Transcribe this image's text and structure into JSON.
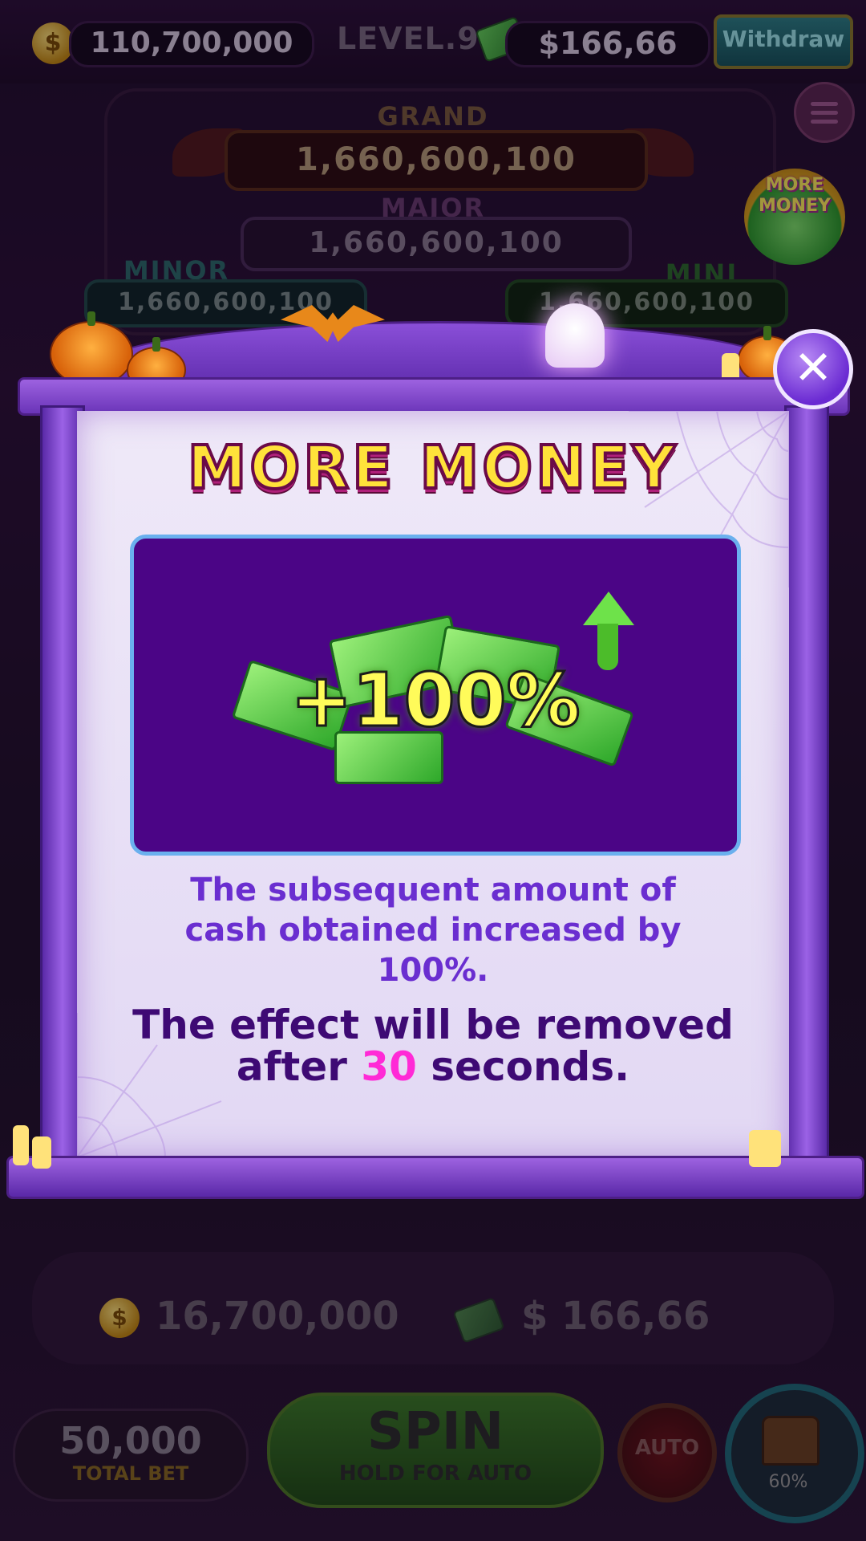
{
  "topbar": {
    "coin_balance": "110,700,000",
    "level_label": "LEVEL.9",
    "cash_balance": "$166,66",
    "withdraw_label": "Withdraw"
  },
  "jackpots": {
    "grand": {
      "label": "GRAND",
      "value": "1,660,600,100"
    },
    "major": {
      "label": "MAJOR",
      "value": "1,660,600,100"
    },
    "minor": {
      "label": "MINOR",
      "value": "1,660,600,100"
    },
    "mini": {
      "label": "MINI",
      "value": "1,660,600,100"
    }
  },
  "badge": {
    "line1": "MORE",
    "line2": "MONEY"
  },
  "popup": {
    "title": "MORE MONEY",
    "bonus_text": "+100%",
    "description": "The subsequent amount of cash obtained increased by 100%.",
    "effect_line1": "The effect will be removed",
    "effect_prefix": "after",
    "effect_seconds": "30",
    "effect_suffix": "seconds.",
    "close_glyph": "✕"
  },
  "bottom": {
    "coin_amount": "16,700,000",
    "cash_amount": "$ 166,66",
    "total_bet_value": "50,000",
    "total_bet_label": "TOTAL BET",
    "spin_label": "SPIN",
    "spin_sub_label": "HOLD FOR AUTO",
    "auto_label": "AUTO",
    "chest_progress": "60%"
  },
  "icons": {
    "coin": "coin-icon",
    "cash": "cash-stack-icon",
    "menu": "hamburger-menu-icon",
    "close": "close-icon",
    "chest": "treasure-chest-icon"
  },
  "colors": {
    "popup_purple": "#6a34b8",
    "title_yellow": "#ffe23a",
    "seconds_pink": "#ff2ad6",
    "description_purple": "#6a2ed0",
    "effect_box": "#4b0586"
  }
}
